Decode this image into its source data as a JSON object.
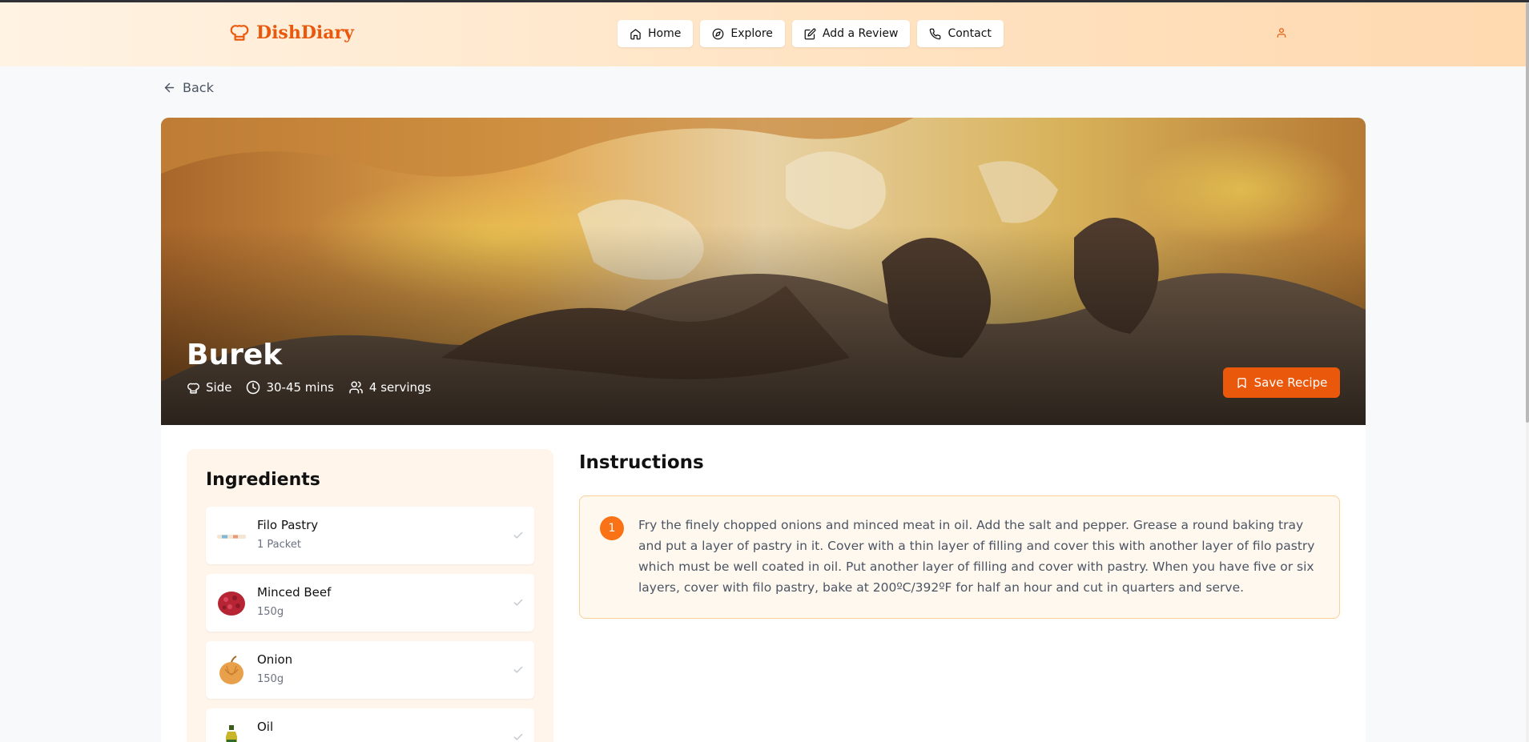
{
  "brand": {
    "name": "DishDiary",
    "color": "#ea580c"
  },
  "nav": {
    "home": "Home",
    "explore": "Explore",
    "add_review": "Add a Review",
    "contact": "Contact"
  },
  "back_label": "Back",
  "recipe": {
    "title": "Burek",
    "category": "Side",
    "time": "30-45 mins",
    "servings": "4 servings",
    "save_label": "Save Recipe"
  },
  "ingredients": {
    "heading": "Ingredients",
    "items": [
      {
        "name": "Filo Pastry",
        "qty": "1 Packet",
        "icon": "filo-pastry-thumbnail"
      },
      {
        "name": "Minced Beef",
        "qty": "150g",
        "icon": "minced-beef-thumbnail"
      },
      {
        "name": "Onion",
        "qty": "150g",
        "icon": "onion-thumbnail"
      },
      {
        "name": "Oil",
        "qty": "",
        "icon": "oil-thumbnail"
      }
    ]
  },
  "instructions": {
    "heading": "Instructions",
    "steps": [
      {
        "number": "1",
        "text": "Fry the finely chopped onions and minced meat in oil. Add the salt and pepper. Grease a round baking tray and put a layer of pastry in it. Cover with a thin layer of filling and cover this with another layer of filo pastry which must be well coated in oil. Put another layer of filling and cover with pastry. When you have five or six layers, cover with filo pastry, bake at 200ºC/392ºF for half an hour and cut in quarters and serve."
      }
    ]
  },
  "colors": {
    "accent": "#ea580c",
    "step_border": "#fbcf95",
    "panel_bg": "#fff5ea"
  }
}
